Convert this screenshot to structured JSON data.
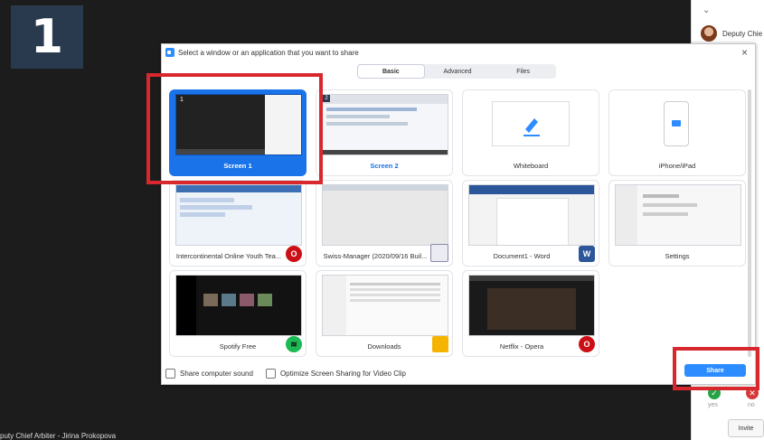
{
  "step_badge": "1",
  "meeting": {
    "bottom_caption": "puty Chief Arbiter - Jirina Prokopova"
  },
  "participants_panel": {
    "participant_name": "Deputy Chie",
    "vote_yes": "yes",
    "vote_no": "no",
    "invite_label": "Invite"
  },
  "dialog": {
    "title": "Select a window or an application that you want to share",
    "close_symbol": "×",
    "tabs": [
      {
        "label": "Basic",
        "active": true
      },
      {
        "label": "Advanced",
        "active": false
      },
      {
        "label": "Files",
        "active": false
      }
    ],
    "tiles": [
      {
        "label": "Screen 1",
        "selected": true,
        "thumb_number": "1"
      },
      {
        "label": "Screen 2",
        "selected": false,
        "thumb_number": "2"
      },
      {
        "label": "Whiteboard",
        "icon": "pen-icon"
      },
      {
        "label": "iPhone/iPad",
        "icon": "phone-icon"
      },
      {
        "label": "Intercontinental Online Youth Tea...",
        "app_icon": "opera-icon",
        "app_glyph": "O",
        "app_color": "#cc0f16"
      },
      {
        "label": "Swiss-Manager (2020/09/16 Buil...",
        "app_icon": "swiss-manager-icon",
        "app_glyph": "",
        "app_color": "#8a8aa8"
      },
      {
        "label": "Document1 - Word",
        "app_icon": "word-icon",
        "app_glyph": "W",
        "app_color": "#2b579a"
      },
      {
        "label": "Settings"
      },
      {
        "label": "Spotify Free",
        "app_icon": "spotify-icon",
        "app_glyph": "≋",
        "app_color": "#1db954"
      },
      {
        "label": "Downloads",
        "app_icon": "folder-icon",
        "app_glyph": "",
        "app_color": "#f4b400"
      },
      {
        "label": "Netflix - Opera",
        "app_icon": "opera-icon",
        "app_glyph": "O",
        "app_color": "#cc0f16"
      }
    ],
    "options": {
      "share_sound": "Share computer sound",
      "optimize_video": "Optimize Screen Sharing for Video Clip"
    },
    "share_button": "Share"
  },
  "colors": {
    "accent": "#2d8cff",
    "selection": "#1a73e8",
    "highlight": "#d8272d",
    "vote_yes": "#27a347",
    "vote_no": "#d53a3a"
  }
}
